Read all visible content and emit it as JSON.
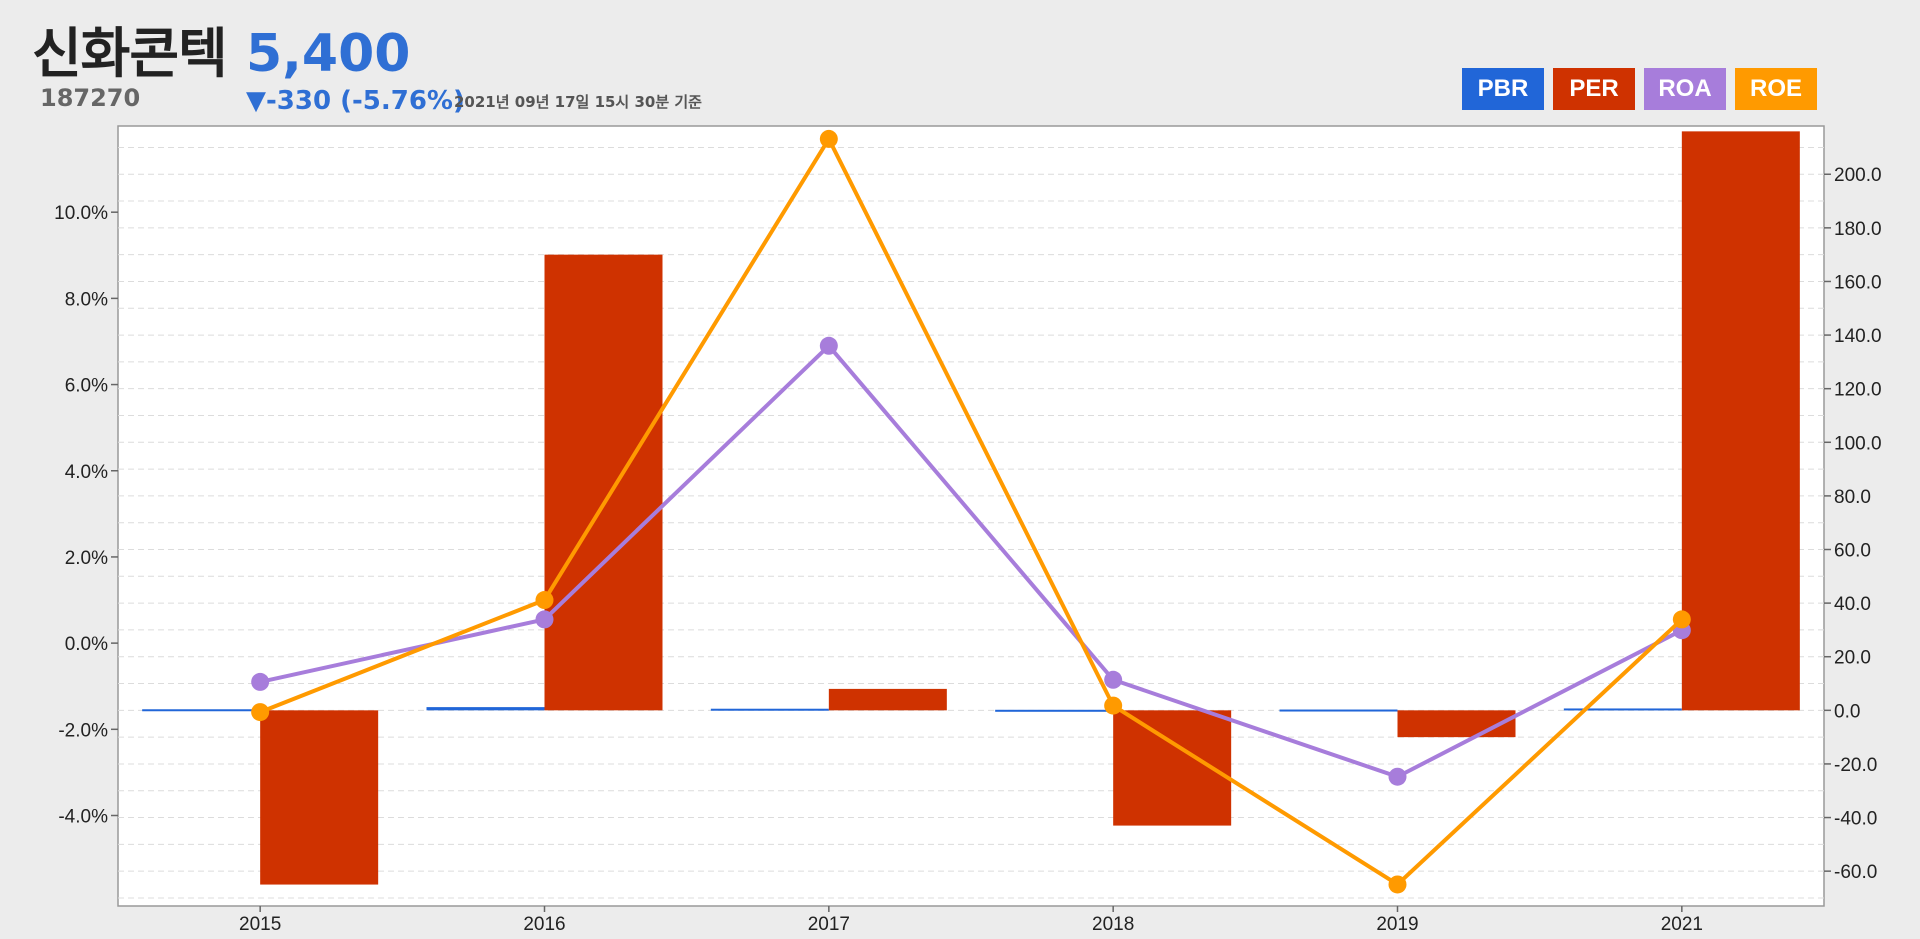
{
  "header": {
    "name": "신화콘텍",
    "code": "187270",
    "price": "5,400",
    "change": "▼-330 (-5.76%)",
    "timestamp": "2021년 09년 17일 15시 30분 기준"
  },
  "legend": [
    {
      "label": "PBR",
      "color": "#2166d8"
    },
    {
      "label": "PER",
      "color": "#cf3200"
    },
    {
      "label": "ROA",
      "color": "#a77ddb"
    },
    {
      "label": "ROE",
      "color": "#ff9a00"
    }
  ],
  "chart_data": {
    "type": "bar",
    "categories": [
      "2015",
      "2016",
      "2017",
      "2018",
      "2019",
      "2021"
    ],
    "left_axis": {
      "ticks": [
        "10.0%",
        "8.0%",
        "6.0%",
        "4.0%",
        "2.0%",
        "0.0%",
        "-2.0%",
        "-4.0%"
      ],
      "tick_values": [
        10,
        8,
        6,
        4,
        2,
        0,
        -2,
        -4
      ],
      "range": [
        -6.1,
        12.0
      ]
    },
    "right_axis": {
      "ticks": [
        "200.0",
        "180.0",
        "160.0",
        "140.0",
        "120.0",
        "100.0",
        "80.0",
        "60.0",
        "40.0",
        "20.0",
        "0.0",
        "-20.0",
        "-40.0",
        "-60.0"
      ],
      "tick_values": [
        200,
        180,
        160,
        140,
        120,
        100,
        80,
        60,
        40,
        20,
        0,
        -20,
        -40,
        -60
      ],
      "range": [
        -73,
        218
      ]
    },
    "grid": true,
    "legend_position": "top-right",
    "series": [
      {
        "name": "PBR",
        "kind": "bar",
        "axis": "right",
        "color": "#2166d8",
        "values": [
          0.4,
          1.2,
          0.6,
          0.2,
          0.3,
          0.7
        ]
      },
      {
        "name": "PER",
        "kind": "bar",
        "axis": "right",
        "color": "#cf3200",
        "values": [
          -65,
          170,
          8,
          -43,
          -10,
          216
        ]
      },
      {
        "name": "ROA",
        "kind": "line",
        "axis": "left",
        "color": "#a77ddb",
        "values": [
          -0.9,
          0.55,
          6.9,
          -0.85,
          -3.1,
          0.3
        ]
      },
      {
        "name": "ROE",
        "kind": "line",
        "axis": "left",
        "color": "#ff9a00",
        "values": [
          -1.6,
          1.0,
          11.7,
          -1.45,
          -5.6,
          0.55
        ]
      }
    ]
  }
}
